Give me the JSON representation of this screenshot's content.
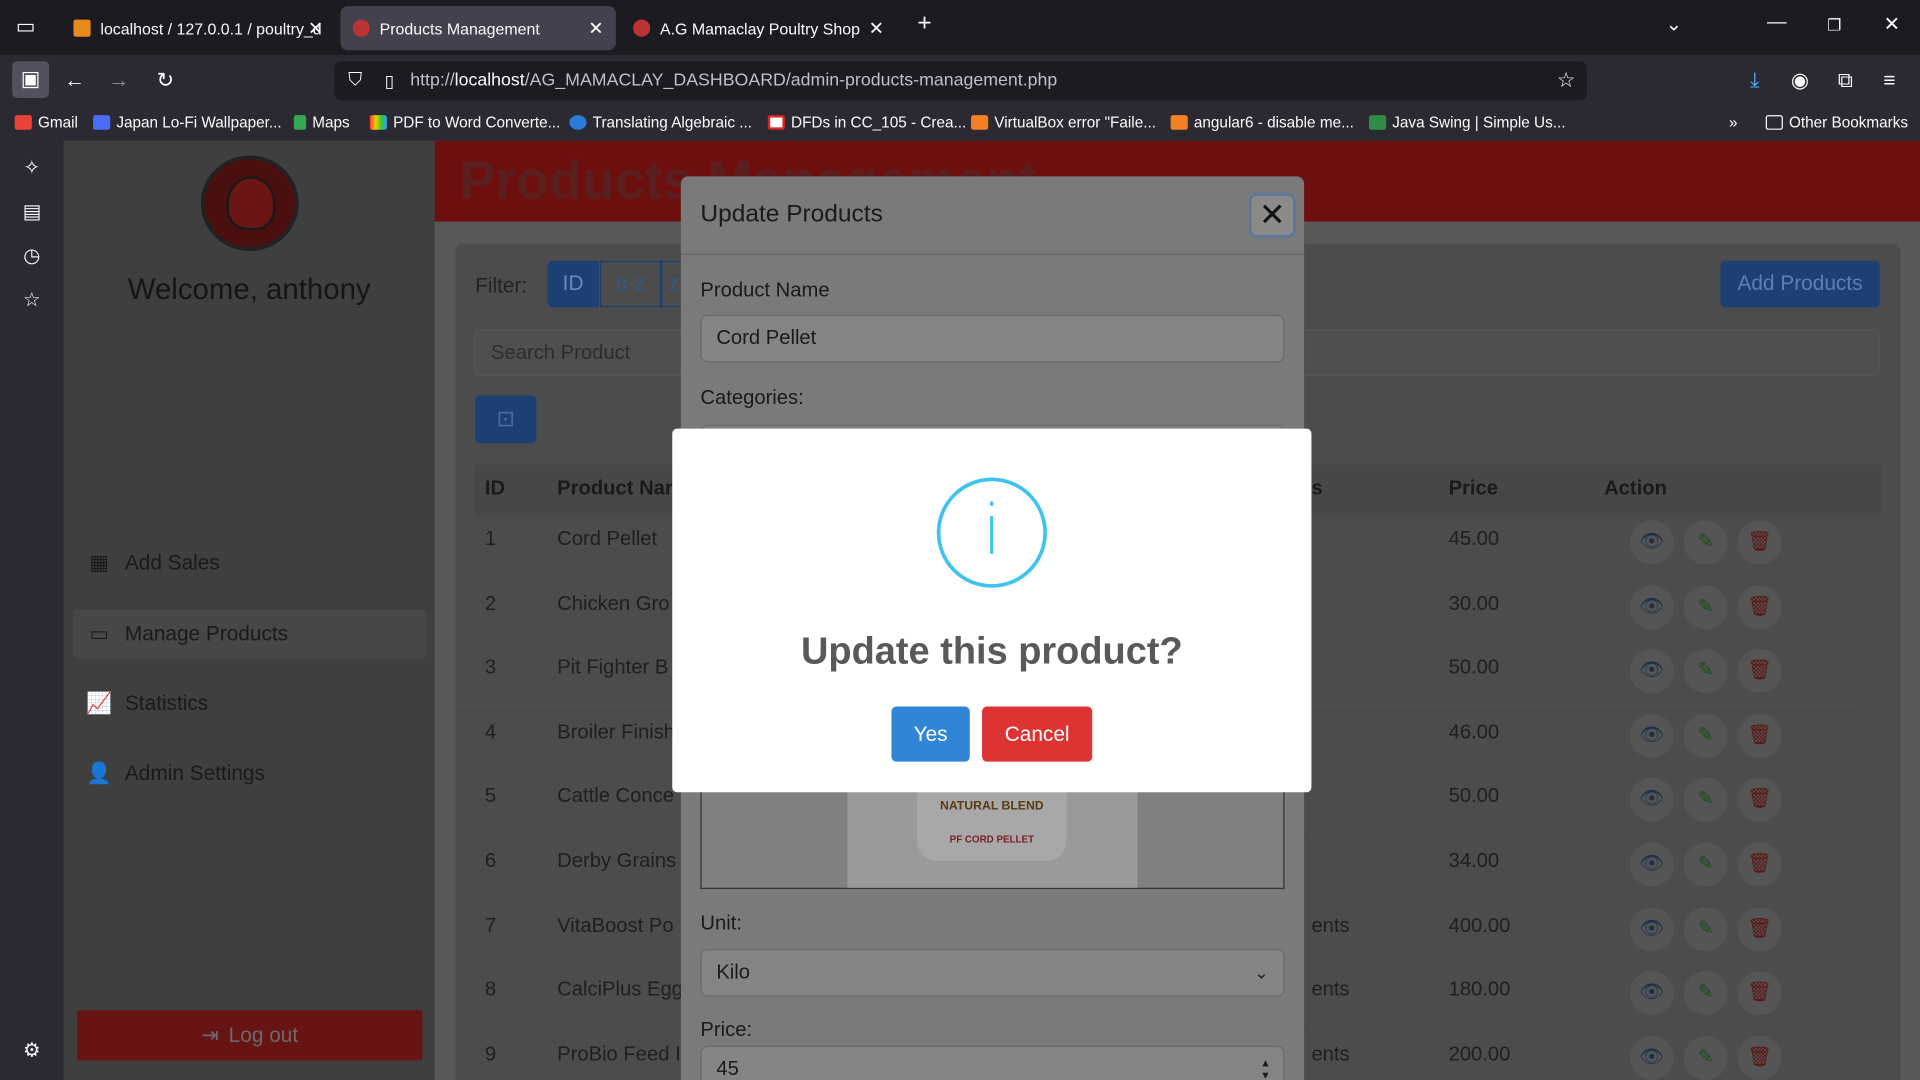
{
  "browser": {
    "tabs": [
      {
        "label": "localhost / 127.0.0.1 / poultry_d",
        "active": false
      },
      {
        "label": "Products Management",
        "active": true
      },
      {
        "label": "A.G Mamaclay Poultry Shop",
        "active": false
      }
    ],
    "url_prefix": "http://",
    "url_host": "localhost",
    "url_path": "/AG_MAMACLAY_DASHBOARD/admin-products-management.php",
    "bookmarks": [
      "Gmail",
      "Japan Lo-Fi Wallpaper...",
      "Maps",
      "PDF to Word Converte...",
      "Translating Algebraic ...",
      "DFDs in CC_105 - Crea...",
      "VirtualBox error \"Faile...",
      "angular6 - disable me...",
      "Java Swing | Simple Us..."
    ],
    "other_bookmarks": "Other Bookmarks"
  },
  "sidebar": {
    "welcome": "Welcome, anthony",
    "items": [
      "Add Sales",
      "Manage Products",
      "Statistics",
      "Admin Settings"
    ],
    "logout": "Log out"
  },
  "header": {
    "title": "Products Management"
  },
  "toolbar": {
    "filter_label": "Filter:",
    "filter_buttons": [
      "ID",
      "a-z",
      "z"
    ],
    "add_button": "Add Products",
    "search_placeholder": "Search Product"
  },
  "table": {
    "headers": [
      "ID",
      "Product Nar",
      "s",
      "Price",
      "Action"
    ],
    "rows": [
      {
        "id": "1",
        "name": "Cord Pellet",
        "cat": "",
        "price": "45.00"
      },
      {
        "id": "2",
        "name": "Chicken Gro",
        "cat": "",
        "price": "30.00"
      },
      {
        "id": "3",
        "name": "Pit Fighter B",
        "cat": "",
        "price": "50.00"
      },
      {
        "id": "4",
        "name": "Broiler Finish",
        "cat": "",
        "price": "46.00"
      },
      {
        "id": "5",
        "name": "Cattle Conce",
        "cat": "",
        "price": "50.00"
      },
      {
        "id": "6",
        "name": "Derby Grains",
        "cat": "",
        "price": "34.00"
      },
      {
        "id": "7",
        "name": "VitaBoost Po",
        "cat": "ents",
        "price": "400.00"
      },
      {
        "id": "8",
        "name": "CalciPlus Egg",
        "cat": "ents",
        "price": "180.00"
      },
      {
        "id": "9",
        "name": "ProBio Feed I",
        "cat": "ents",
        "price": "200.00"
      }
    ]
  },
  "update_modal": {
    "title": "Update Products",
    "product_name_label": "Product Name",
    "product_name_value": "Cord Pellet",
    "categories_label": "Categories:",
    "bag_text_1": "NATURAL BLEND",
    "bag_text_2": "PF CORD PELLET",
    "unit_label": "Unit:",
    "unit_value": "Kilo",
    "price_label": "Price:",
    "price_value": "45"
  },
  "confirm": {
    "icon": "i",
    "title": "Update this product?",
    "yes": "Yes",
    "cancel": "Cancel",
    "yes_color": "#3085d6",
    "cancel_color": "#dd3333"
  }
}
